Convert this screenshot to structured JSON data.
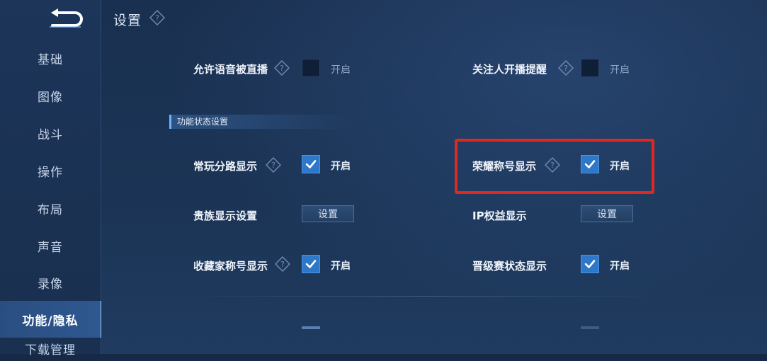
{
  "sidebar": {
    "items": [
      {
        "label": "基础"
      },
      {
        "label": "图像"
      },
      {
        "label": "战斗"
      },
      {
        "label": "操作"
      },
      {
        "label": "布局"
      },
      {
        "label": "声音"
      },
      {
        "label": "录像"
      },
      {
        "label": "功能/隐私",
        "active": true
      },
      {
        "label": "下载管理"
      }
    ]
  },
  "header": {
    "title": "设置"
  },
  "rows": {
    "voice_broadcast": {
      "label": "允许语音被直播",
      "option": "开启",
      "checked": false
    },
    "follow_stream_alert": {
      "label": "关注人开播提醒",
      "option": "开启",
      "checked": false
    },
    "section_title": "功能状态设置",
    "frequent_lane": {
      "label": "常玩分路显示",
      "option": "开启",
      "checked": true
    },
    "honor_title": {
      "label": "荣耀称号显示",
      "option": "开启",
      "checked": true
    },
    "noble_display": {
      "label": "贵族显示设置",
      "button": "设置"
    },
    "ip_benefits": {
      "label": "IP权益显示",
      "button": "设置"
    },
    "collector_title": {
      "label": "收藏家称号显示",
      "option": "开启",
      "checked": true
    },
    "rank_promotion": {
      "label": "晋级赛状态显示",
      "option": "开启",
      "checked": true
    }
  },
  "colors": {
    "accent": "#2f77c8",
    "highlight": "#e0281f",
    "background": "#1a3050"
  }
}
